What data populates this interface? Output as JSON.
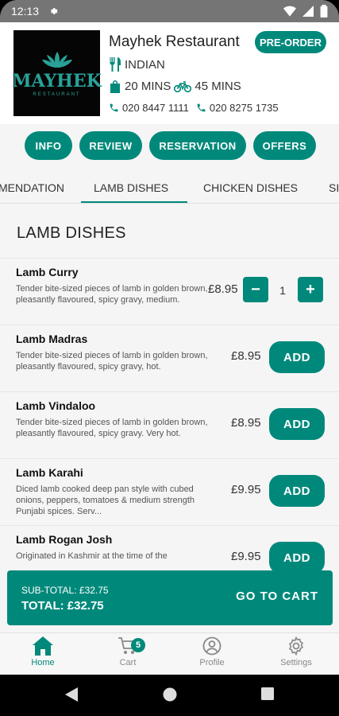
{
  "status": {
    "time": "12:13"
  },
  "restaurant": {
    "logo_word": "MAYHEK",
    "logo_sub": "RESTAURANT",
    "name": "Mayhek Restaurant",
    "preorder_label": "PRE-ORDER",
    "cuisine": "INDIAN",
    "delivery_time": "20 MINS",
    "collection_time": "45 MINS",
    "phone_1": "020 8447 1111",
    "phone_2": "020 8275 1735"
  },
  "pills": [
    "INFO",
    "REVIEW",
    "RESERVATION",
    "OFFERS"
  ],
  "categories": [
    "MENDATION",
    "LAMB DISHES",
    "CHICKEN DISHES",
    "SI"
  ],
  "active_category": "LAMB DISHES",
  "section_title": "LAMB DISHES",
  "dishes": [
    {
      "name": "Lamb Curry",
      "desc": "Tender bite-sized pieces of lamb in golden brown, pleasantly flavoured, spicy gravy, medium.",
      "price": "£8.95",
      "quantity": "1"
    },
    {
      "name": "Lamb Madras",
      "desc": "Tender bite-sized pieces of lamb in golden brown, pleasantly flavoured, spicy gravy, hot.",
      "price": "£8.95",
      "button": "ADD"
    },
    {
      "name": "Lamb Vindaloo",
      "desc": "Tender bite-sized pieces of lamb in golden brown, pleasantly flavoured, spicy gravy. Very hot.",
      "price": "£8.95",
      "button": "ADD"
    },
    {
      "name": "Lamb Karahi",
      "desc": "Diced lamb cooked deep pan style with cubed onions, peppers, tomatoes & medium strength Punjabi spices. Serv...",
      "price": "£9.95",
      "button": "ADD"
    },
    {
      "name": "Lamb Rogan Josh",
      "desc": "Originated in Kashmir at the time of the",
      "price": "£9.95",
      "button": "ADD"
    }
  ],
  "cart": {
    "subtotal": "SUB-TOTAL: £32.75",
    "total": "TOTAL: £32.75",
    "go_label": "GO TO CART"
  },
  "nav": {
    "home": "Home",
    "cart": "Cart",
    "cart_count": "5",
    "profile": "Profile",
    "settings": "Settings"
  },
  "colors": {
    "accent": "#00897b"
  }
}
